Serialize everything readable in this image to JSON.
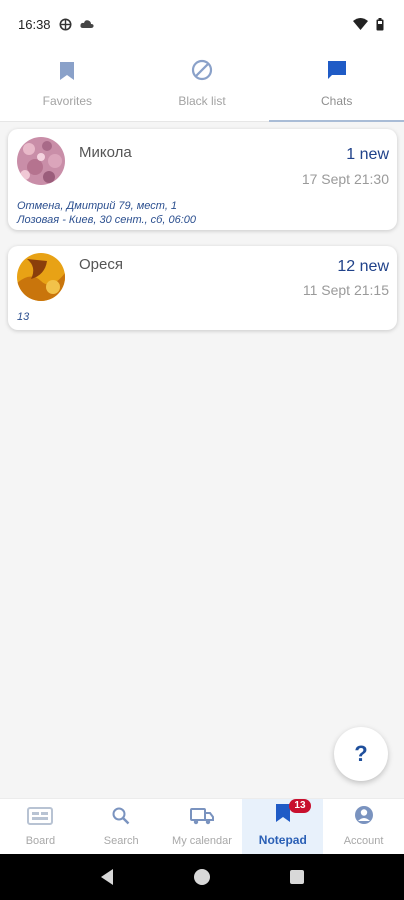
{
  "status_bar": {
    "time": "16:38",
    "icons": [
      "vpn-icon",
      "cloud-icon",
      "wifi-icon",
      "battery-icon"
    ]
  },
  "tabs": [
    {
      "label": "Favorites",
      "icon": "bookmark-icon"
    },
    {
      "label": "Black list",
      "icon": "block-icon"
    },
    {
      "label": "Chats",
      "icon": "chat-icon",
      "active": true
    }
  ],
  "chats": [
    {
      "name": "Микола",
      "new_count": "1 new",
      "time": "17 Sept  21:30",
      "preview": [
        "Отмена, Дмитрий 79, мест, 1",
        "Лозовая - Киев, 30 сент., сб, 06:00"
      ]
    },
    {
      "name": "Ореся",
      "new_count": "12 new",
      "time": "11 Sept  21:15",
      "preview": [
        "13"
      ]
    }
  ],
  "help_button": "?",
  "bottom_nav": [
    {
      "label": "Board",
      "icon": "board-icon"
    },
    {
      "label": "Search",
      "icon": "search-icon"
    },
    {
      "label": "My calendar",
      "icon": "calendar-truck-icon"
    },
    {
      "label": "Notepad",
      "icon": "bookmark-icon",
      "active": true,
      "badge": "13"
    },
    {
      "label": "Account",
      "icon": "account-icon"
    }
  ],
  "colors": {
    "accent": "#1f5bc6",
    "tab_inactive": "#8aa1c9",
    "badge": "#c8102e"
  }
}
